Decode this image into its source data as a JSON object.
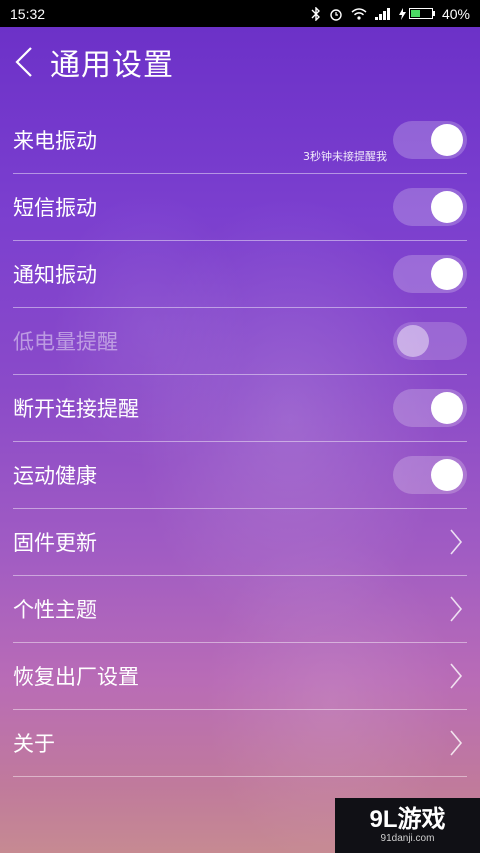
{
  "status_bar": {
    "time": "15:32",
    "battery": "40%"
  },
  "header": {
    "title": "通用设置"
  },
  "settings": [
    {
      "label": "来电振动",
      "control": "toggle",
      "on": true,
      "hint": "3秒钟未接提醒我"
    },
    {
      "label": "短信振动",
      "control": "toggle",
      "on": true
    },
    {
      "label": "通知振动",
      "control": "toggle",
      "on": true
    },
    {
      "label": "低电量提醒",
      "control": "toggle",
      "on": false,
      "disabled": true
    },
    {
      "label": "断开连接提醒",
      "control": "toggle",
      "on": true
    },
    {
      "label": "运动健康",
      "control": "toggle",
      "on": true
    },
    {
      "label": "固件更新",
      "control": "chevron"
    },
    {
      "label": "个性主题",
      "control": "chevron"
    },
    {
      "label": "恢复出厂设置",
      "control": "chevron"
    },
    {
      "label": "关于",
      "control": "chevron"
    }
  ],
  "watermark": {
    "main": "9L游戏",
    "sub": "91danji.com"
  },
  "colors": {
    "bg_top": "#6a2fc7",
    "bg_bottom": "#c68a92",
    "battery_green": "#4cd964"
  }
}
